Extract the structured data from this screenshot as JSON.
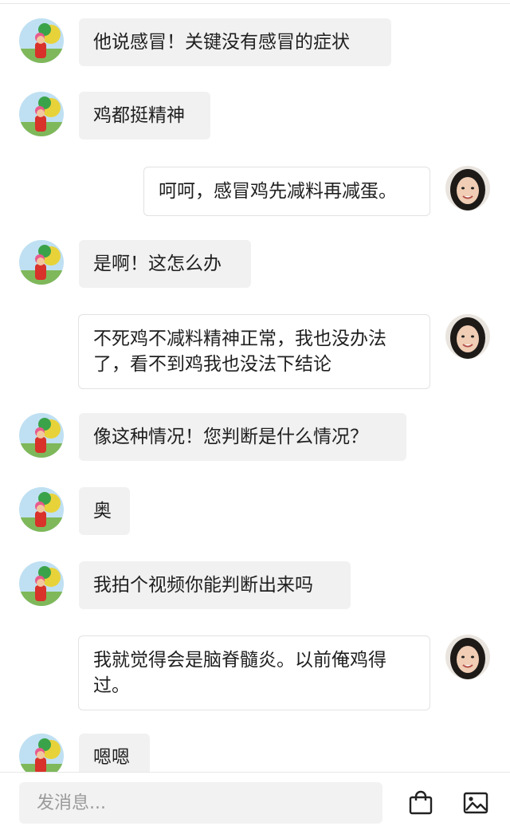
{
  "messages": [
    {
      "side": "left",
      "text": "他说感冒！关键没有感冒的症状"
    },
    {
      "side": "left",
      "text": "鸡都挺精神"
    },
    {
      "side": "right",
      "text": "呵呵，感冒鸡先减料再减蛋。"
    },
    {
      "side": "left",
      "text": "是啊！这怎么办"
    },
    {
      "side": "right",
      "text": "不死鸡不减料精神正常，我也没办法了，看不到鸡我也没法下结论"
    },
    {
      "side": "left",
      "text": "像这种情况！您判断是什么情况？"
    },
    {
      "side": "left",
      "text": "奥"
    },
    {
      "side": "left",
      "text": "我拍个视频你能判断出来吗"
    },
    {
      "side": "right",
      "text": "我就觉得会是脑脊髓炎。以前俺鸡得过。"
    },
    {
      "side": "left",
      "text": "嗯嗯"
    }
  ],
  "input": {
    "placeholder": "发消息..."
  },
  "icons": {
    "shop": "shopping-bag-icon",
    "image": "image-icon"
  }
}
